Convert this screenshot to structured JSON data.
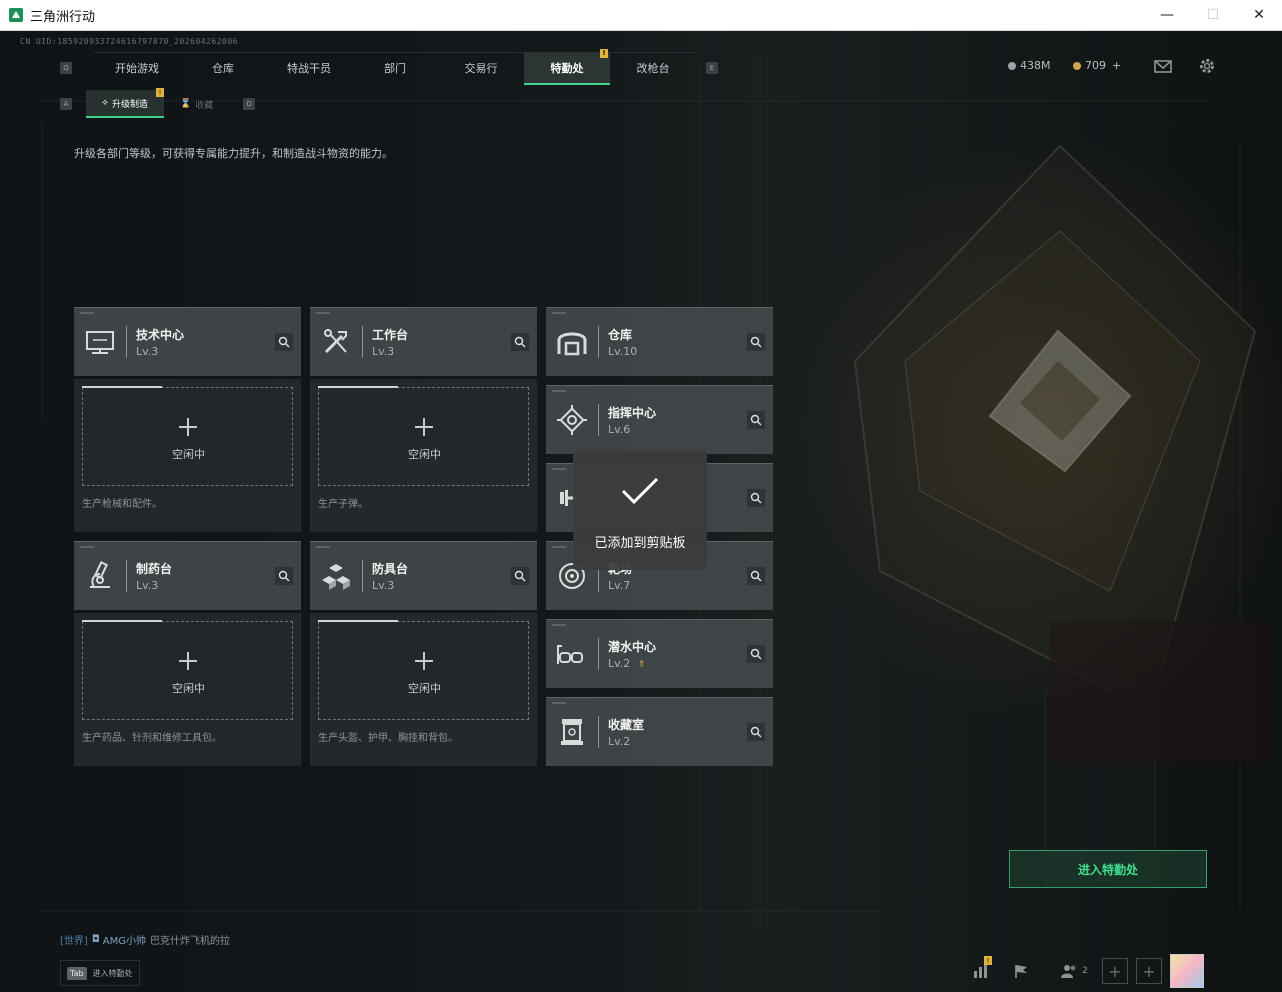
{
  "window": {
    "title": "三角洲行动",
    "minimize": "—",
    "maximize": "☐",
    "close": "✕"
  },
  "uid": "CN UID:185920933724616797870_202604262006",
  "nav": {
    "left_key": "Q",
    "right_key": "E",
    "tabs": [
      {
        "label": "开始游戏",
        "active": false
      },
      {
        "label": "仓库",
        "active": false
      },
      {
        "label": "特战干员",
        "active": false
      },
      {
        "label": "部门",
        "active": false
      },
      {
        "label": "交易行",
        "active": false
      },
      {
        "label": "特勤处",
        "active": true,
        "badge": "!"
      },
      {
        "label": "改枪台",
        "active": false
      }
    ]
  },
  "currency": {
    "money": "438M",
    "coupons": "709",
    "coupons_plus": "+"
  },
  "subnav": {
    "left_key": "A",
    "right_key": "D",
    "tabs": [
      {
        "label": "升级制造",
        "active": true,
        "badge": "!"
      },
      {
        "label": "收藏",
        "active": false
      }
    ]
  },
  "description": "升级各部门等级，可获得专属能力提升，和制造战斗物资的能力。",
  "facilities": {
    "tech": {
      "name": "技术中心",
      "level": "Lv.3",
      "icon": "monitor-icon",
      "status": "空闲中",
      "produces": "生产枪械和配件。"
    },
    "workbench": {
      "name": "工作台",
      "level": "Lv.3",
      "icon": "tools-icon",
      "status": "空闲中",
      "produces": "生产子弹。"
    },
    "pharmacy": {
      "name": "制药台",
      "level": "Lv.3",
      "icon": "microscope-icon",
      "status": "空闲中",
      "produces": "生产药品、针剂和维修工具包。"
    },
    "armor": {
      "name": "防具台",
      "level": "Lv.3",
      "icon": "blocks-icon",
      "status": "空闲中",
      "produces": "生产头盔、护甲、胸挂和背包。"
    },
    "storage": {
      "name": "仓库",
      "level": "Lv.10",
      "icon": "warehouse-icon"
    },
    "command": {
      "name": "指挥中心",
      "level": "Lv.6",
      "icon": "chip-icon"
    },
    "gym": {
      "name": "",
      "level": "",
      "icon": "dumbbell-icon"
    },
    "range": {
      "name": "靶场",
      "level": "Lv.7",
      "icon": "target-icon"
    },
    "diving": {
      "name": "潜水中心",
      "level": "Lv.2",
      "icon": "diving-mask-icon"
    },
    "collection": {
      "name": "收藏室",
      "level": "Lv.2",
      "icon": "trophy-icon"
    }
  },
  "toast": {
    "message": "已添加到剪贴板"
  },
  "enter_button": "进入特勤处",
  "chat": {
    "channel": "[世界]",
    "user": "AMG小帅",
    "message": "巴克什炸飞机的拉"
  },
  "tab_hint": {
    "key": "Tab",
    "label": "进入特勤处"
  },
  "friends_count": "2",
  "stats_badge": "!",
  "colors": {
    "accent": "#3fd08a",
    "badge": "#e1b23c",
    "panel": "#484e50"
  }
}
